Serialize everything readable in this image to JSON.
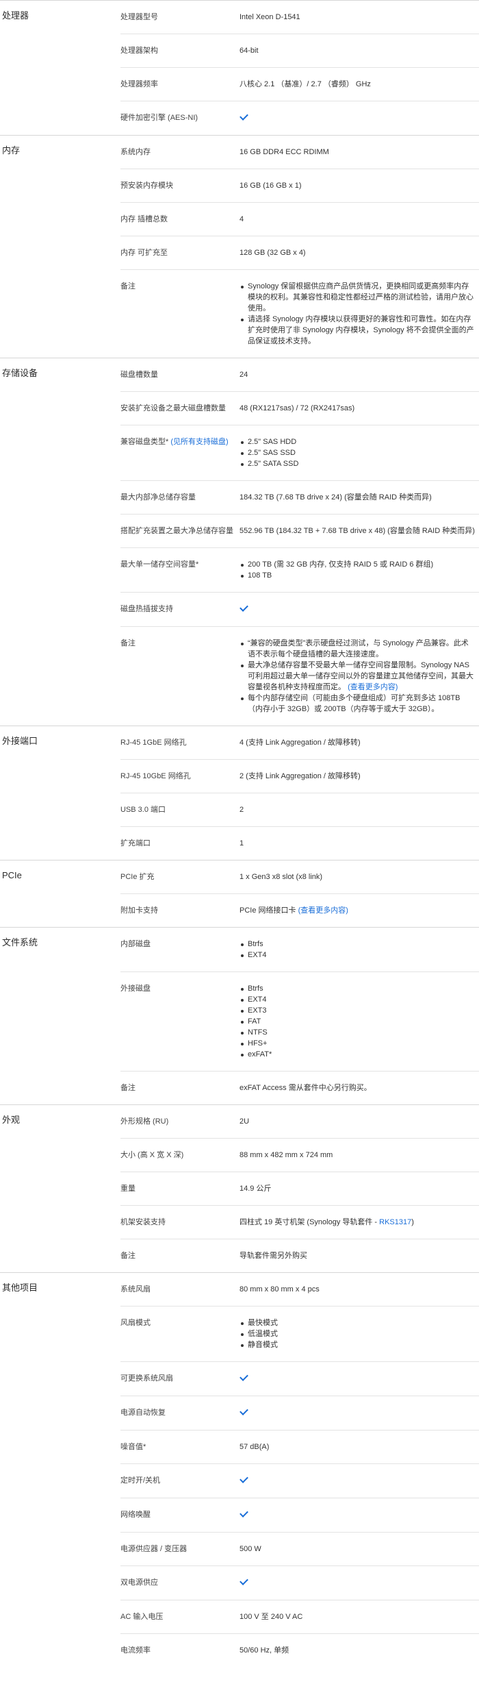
{
  "colors": {
    "accent": "#1a6ed8",
    "divider": "#e3e3e3"
  },
  "sections": [
    {
      "title": "处理器",
      "rows": [
        {
          "label": "处理器型号",
          "value": "Intel Xeon D-1541"
        },
        {
          "label": "处理器架构",
          "value": "64-bit"
        },
        {
          "label": "处理器频率",
          "value": "八核心 2.1 （基准）/ 2.7 （睿频） GHz"
        },
        {
          "label": "硬件加密引擎 (AES-NI)",
          "check": true
        }
      ]
    },
    {
      "title": "内存",
      "rows": [
        {
          "label": "系统内存",
          "value": "16 GB DDR4 ECC RDIMM"
        },
        {
          "label": "预安装内存模块",
          "value": "16 GB (16 GB x 1)"
        },
        {
          "label": "内存 插槽总数",
          "value": "4"
        },
        {
          "label": "内存 可扩充至",
          "value": "128 GB (32 GB x 4)"
        },
        {
          "label": "备注",
          "list": [
            "Synology 保留根据供应商产品供货情况，更换相同或更高频率内存模块的权利。其兼容性和稳定性都经过严格的测试检验，请用户放心使用。",
            "请选择 Synology 内存模块以获得更好的兼容性和可靠性。如在内存扩充时使用了非 Synology 内存模块，Synology 将不会提供全面的产品保证或技术支持。"
          ]
        }
      ]
    },
    {
      "title": "存储设备",
      "rows": [
        {
          "label": "磁盘槽数量",
          "value": "24"
        },
        {
          "label": "安装扩充设备之最大磁盘槽数量",
          "value": "48 (RX1217sas) / 72 (RX2417sas)"
        },
        {
          "label": "兼容磁盘类型*",
          "label_link": "(见所有支持磁盘)",
          "list": [
            "2.5\" SAS HDD",
            "2.5\" SAS SSD",
            "2.5\" SATA SSD"
          ]
        },
        {
          "label": "最大内部净总储存容量",
          "value": "184.32 TB (7.68 TB drive x 24) (容量会随 RAID 种类而异)"
        },
        {
          "label": "搭配扩充装置之最大净总储存容量",
          "value": "552.96 TB (184.32 TB + 7.68 TB drive x 48) (容量会随 RAID 种类而异)"
        },
        {
          "label": "最大单一储存空间容量*",
          "list": [
            "200 TB (需 32 GB 内存, 仅支持 RAID 5 或 RAID 6 群组)",
            "108 TB"
          ]
        },
        {
          "label": "磁盘热插拔支持",
          "check": true
        },
        {
          "label": "备注",
          "list": [
            "“兼容的硬盘类型”表示硬盘经过测试，与 Synology 产品兼容。此术语不表示每个硬盘插槽的最大连接速度。",
            "最大净总储存容量不受最大单一储存空间容量限制。Synology NAS 可利用超过最大单一储存空间以外的容量建立其他储存空间，其最大容量视各机种支持程度而定。",
            "每个内部存储空间（可能由多个硬盘组成）可扩充到多达 108TB（内存小于 32GB）或 200TB（内存等于或大于 32GB）。"
          ],
          "link_item": 1,
          "link_text": "(查看更多内容)"
        }
      ]
    },
    {
      "title": "外接端口",
      "rows": [
        {
          "label": "RJ-45 1GbE 网络孔",
          "value": "4 (支持 Link Aggregation / 故障移转)"
        },
        {
          "label": "RJ-45 10GbE 网络孔",
          "value": "2 (支持 Link Aggregation / 故障移转)"
        },
        {
          "label": "USB 3.0 端口",
          "value": "2"
        },
        {
          "label": "扩充端口",
          "value": "1"
        }
      ]
    },
    {
      "title": "PCIe",
      "rows": [
        {
          "label": "PCIe 扩充",
          "value": "1 x Gen3 x8 slot (x8 link)"
        },
        {
          "label": "附加卡支持",
          "value": "PCIe 网络接口卡",
          "value_link": "(查看更多内容)"
        }
      ]
    },
    {
      "title": "文件系统",
      "rows": [
        {
          "label": "内部磁盘",
          "list": [
            "Btrfs",
            "EXT4"
          ]
        },
        {
          "label": "外接磁盘",
          "list": [
            "Btrfs",
            "EXT4",
            "EXT3",
            "FAT",
            "NTFS",
            "HFS+",
            "exFAT*"
          ]
        },
        {
          "label": "备注",
          "value": "exFAT Access 需从套件中心另行购买。"
        }
      ]
    },
    {
      "title": "外观",
      "rows": [
        {
          "label": "外形规格 (RU)",
          "value": "2U"
        },
        {
          "label": "大小 (高 X 宽 X 深)",
          "value": "88 mm x 482 mm x 724 mm"
        },
        {
          "label": "重量",
          "value": "14.9 公斤"
        },
        {
          "label": "机架安装支持",
          "value": "四柱式 19 英寸机架 (Synology 导轨套件 - ",
          "value_link": "RKS1317",
          "value_suffix": ")"
        },
        {
          "label": "备注",
          "value": "导轨套件需另外购买"
        }
      ]
    },
    {
      "title": "其他项目",
      "rows": [
        {
          "label": "系统风扇",
          "value": "80 mm x 80 mm x 4 pcs"
        },
        {
          "label": "风扇模式",
          "list": [
            "最快模式",
            "低温模式",
            "静音模式"
          ]
        },
        {
          "label": "可更换系统风扇",
          "check": true
        },
        {
          "label": "电源自动恢复",
          "check": true
        },
        {
          "label": "噪音值*",
          "value": "57 dB(A)"
        },
        {
          "label": "定时开/关机",
          "check": true
        },
        {
          "label": "网络唤醒",
          "check": true
        },
        {
          "label": "电源供应器 / 变压器",
          "value": "500 W"
        },
        {
          "label": "双电源供应",
          "check": true
        },
        {
          "label": "AC 输入电压",
          "value": "100 V 至 240 V AC"
        },
        {
          "label": "电流频率",
          "value": "50/60 Hz, 单频"
        }
      ]
    }
  ]
}
